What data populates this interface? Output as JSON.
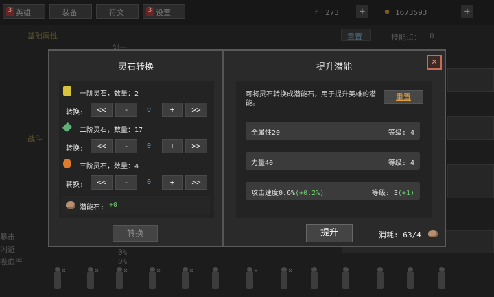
{
  "background": {
    "tabs": [
      {
        "badge": "3",
        "label": "英雄"
      },
      {
        "badge": "",
        "label": "装备"
      },
      {
        "badge": "",
        "label": "符文"
      },
      {
        "badge": "3",
        "label": "设置"
      }
    ],
    "energy": "273",
    "coins": "1673593",
    "section_label": "基础属性",
    "hero_class": "剑士",
    "battle_label": "战斗",
    "reset_label": "重置",
    "skill_points_label": "技能点：",
    "skill_points": "0",
    "left_list": [
      "暴击",
      "闪避",
      "吸血率"
    ],
    "percent_values": [
      "0%",
      "0%"
    ]
  },
  "modal": {
    "left_title": "灵石转换",
    "control_label": "转换:",
    "stones": [
      {
        "name": "一阶灵石，数量：",
        "count": "2",
        "value": "0",
        "color": "#d8c23c",
        "glyph": "1"
      },
      {
        "name": "二阶灵石，数量：",
        "count": "17",
        "value": "0",
        "color": "#5fae76",
        "glyph": "2"
      },
      {
        "name": "三阶灵石，数量：",
        "count": "4",
        "value": "0",
        "color": "#e07a2c",
        "glyph": "3"
      }
    ],
    "buttons": {
      "first": "<<",
      "dec": "-",
      "inc": "+",
      "last": ">>"
    },
    "potential_label": "潜能石:",
    "potential_value": "+0",
    "convert_button": "转换",
    "right_title": "提升潜能",
    "description": "可将灵石转换成潜能石，用于提升英雄的潜能。",
    "reset_button": "重置",
    "attributes": [
      {
        "name": "全属性20",
        "bonus": "",
        "level": "等级: 4",
        "level_bonus": ""
      },
      {
        "name": "力量40",
        "bonus": "",
        "level": "等级: 4",
        "level_bonus": ""
      },
      {
        "name": "攻击速度0.6%",
        "bonus": "(+0.2%)",
        "level": "等级: 3",
        "level_bonus": "(+1)"
      }
    ],
    "upgrade_button": "提升",
    "cost_label": "消耗:",
    "cost_value": "63/4",
    "close_glyph": "✕",
    "colors": {
      "accent_green": "#6fd46f",
      "value_blue": "#5aa9e6",
      "reset_orange": "#e0a03c",
      "close_red": "#c96b52"
    }
  }
}
